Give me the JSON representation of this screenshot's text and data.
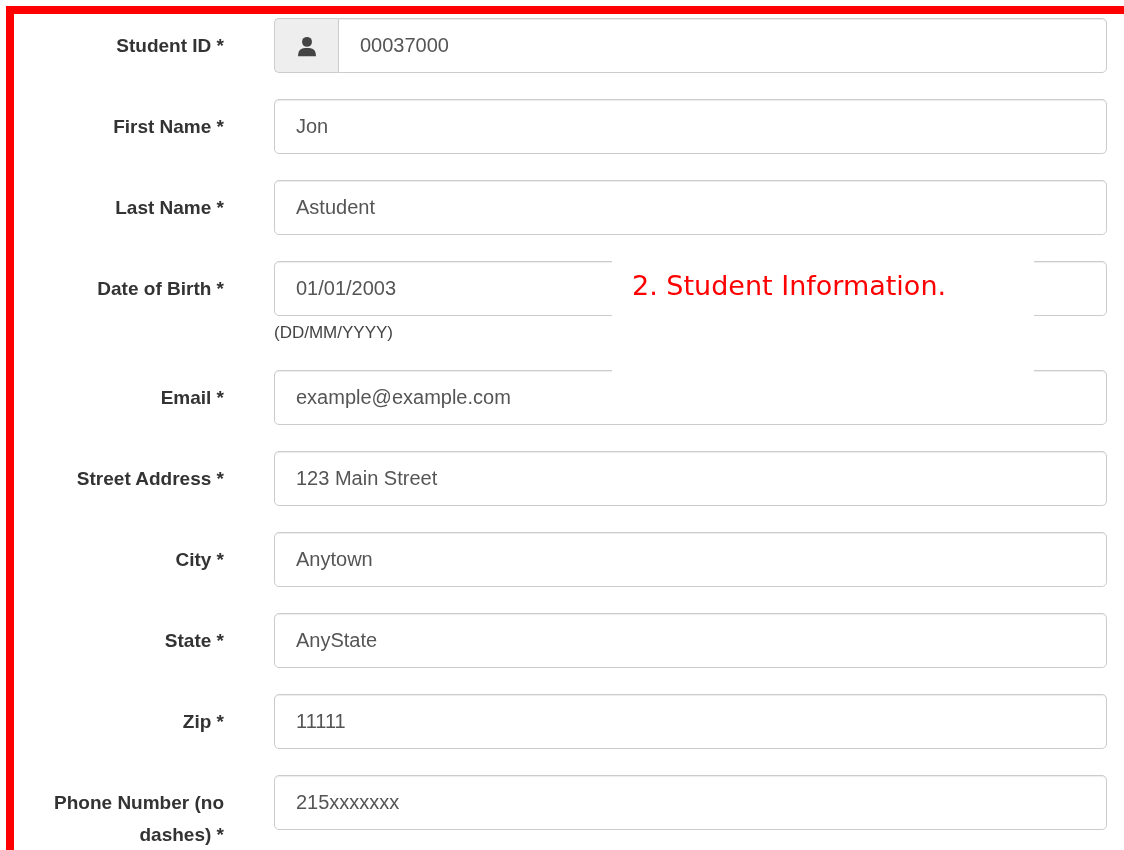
{
  "fields": [
    {
      "label": "Student ID *",
      "value": "00037000",
      "kind": "icon-addon"
    },
    {
      "label": "First Name *",
      "value": "Jon",
      "kind": "plain"
    },
    {
      "label": "Last Name *",
      "value": "Astudent",
      "kind": "plain"
    },
    {
      "label": "Date of Birth *",
      "value": "01/01/2003",
      "kind": "plain",
      "help": "(DD/MM/YYYY)"
    },
    {
      "label": "Email *",
      "value": "example@example.com",
      "kind": "plain"
    },
    {
      "label": "Street Address *",
      "value": "123 Main Street",
      "kind": "plain"
    },
    {
      "label": "City *",
      "value": "Anytown",
      "kind": "plain"
    },
    {
      "label": "State *",
      "value": "AnyState",
      "kind": "plain"
    },
    {
      "label": "Zip *",
      "value": "11111",
      "kind": "plain"
    },
    {
      "label": "Phone Number (no dashes) *",
      "value": "215xxxxxxx",
      "kind": "plain"
    }
  ],
  "callout": {
    "text": "2. Student Information."
  }
}
